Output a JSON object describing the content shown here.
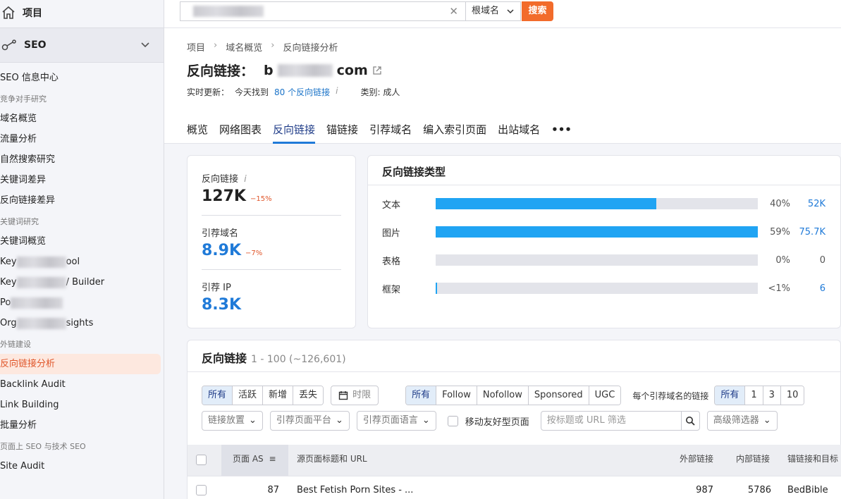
{
  "sidebar": {
    "projects_label": "项目",
    "seo_label": "SEO",
    "items": [
      {
        "type": "item",
        "label": "SEO 信息中心"
      },
      {
        "type": "group",
        "label": "竞争对手研究"
      },
      {
        "type": "item",
        "label": "域名概览"
      },
      {
        "type": "item",
        "label": "流量分析"
      },
      {
        "type": "item",
        "label": "自然搜索研究"
      },
      {
        "type": "item",
        "label": "关键词差异"
      },
      {
        "type": "item",
        "label": "反向链接差异"
      },
      {
        "type": "group",
        "label": "关键词研究"
      },
      {
        "type": "item",
        "label": "关键词概览"
      },
      {
        "type": "item",
        "label": "Key",
        "suffix": "ool"
      },
      {
        "type": "item",
        "label": "Key",
        "suffix": "/ Builder"
      },
      {
        "type": "item",
        "label": "Po",
        "suffix": ""
      },
      {
        "type": "item",
        "label": "Org",
        "suffix": "sights"
      },
      {
        "type": "group",
        "label": "外链建设"
      },
      {
        "type": "item",
        "label": "反向链接分析",
        "active": true
      },
      {
        "type": "item",
        "label": "Backlink Audit"
      },
      {
        "type": "item",
        "label": "Link Building"
      },
      {
        "type": "item",
        "label": "批量分析"
      },
      {
        "type": "group",
        "label": "页面上 SEO 与技术 SEO"
      },
      {
        "type": "item",
        "label": "Site Audit"
      }
    ]
  },
  "search": {
    "root_label": "根域名",
    "button_label": "搜索"
  },
  "breadcrumb": [
    "项目",
    "域名概览",
    "反向链接分析"
  ],
  "title": {
    "prefix": "反向链接：",
    "domain_start": "b",
    "domain_end": "com"
  },
  "meta": {
    "realtime_label": "实时更新：",
    "today_label": "今天找到",
    "found_link": "80 个反向链接",
    "category_label": "类别: 成人"
  },
  "tabs": [
    "概览",
    "网络图表",
    "反向链接",
    "锚链接",
    "引荐域名",
    "编入索引页面",
    "出站域名"
  ],
  "active_tab": 2,
  "more_label": "•••",
  "metrics": [
    {
      "label": "反向链接",
      "value": "127K",
      "delta": "−15%",
      "style": "dark",
      "info": true
    },
    {
      "label": "引荐域名",
      "value": "8.9K",
      "delta": "−7%",
      "style": "blue",
      "info": false
    },
    {
      "label": "引荐 IP",
      "value": "8.3K",
      "delta": "",
      "style": "blue",
      "info": false
    }
  ],
  "link_types": {
    "title": "反向链接类型",
    "rows": [
      {
        "label": "文本",
        "fill": 0.685,
        "pct": "40%",
        "count": "52K"
      },
      {
        "label": "图片",
        "fill": 1.0,
        "pct": "59%",
        "count": "75.7K"
      },
      {
        "label": "表格",
        "fill": 0.0,
        "pct": "0%",
        "count": "0"
      },
      {
        "label": "框架",
        "fill": 0.004,
        "pct": "<1%",
        "count": "6"
      }
    ]
  },
  "backlinks": {
    "title": "反向链接",
    "count": "1 - 100 (~126,601)",
    "status_tabs": [
      "所有",
      "活跃",
      "新增",
      "丢失"
    ],
    "period_label": "时限",
    "follow_tabs": [
      "所有",
      "Follow",
      "Nofollow",
      "Sponsored",
      "UGC"
    ],
    "per_domain_label": "每个引荐域名的链接",
    "per_domain_tabs": [
      "所有",
      "1",
      "3",
      "10"
    ],
    "dd_placement": "链接放置",
    "dd_platform": "引荐页面平台",
    "dd_language": "引荐页面语言",
    "mobile_label": "移动友好型页面",
    "filter_placeholder": "按标题或 URL 筛选",
    "advanced_label": "高级筛选器",
    "columns": {
      "page_as": "页面 AS",
      "source": "源页面标题和 URL",
      "external": "外部链接",
      "internal": "内部链接",
      "anchor": "锚链接和目标 U"
    },
    "rows": [
      {
        "page_as": "87",
        "source": "Best Fetish Porn Sites - ...",
        "external": "987",
        "internal": "5786",
        "anchor": "BedBible"
      }
    ]
  }
}
